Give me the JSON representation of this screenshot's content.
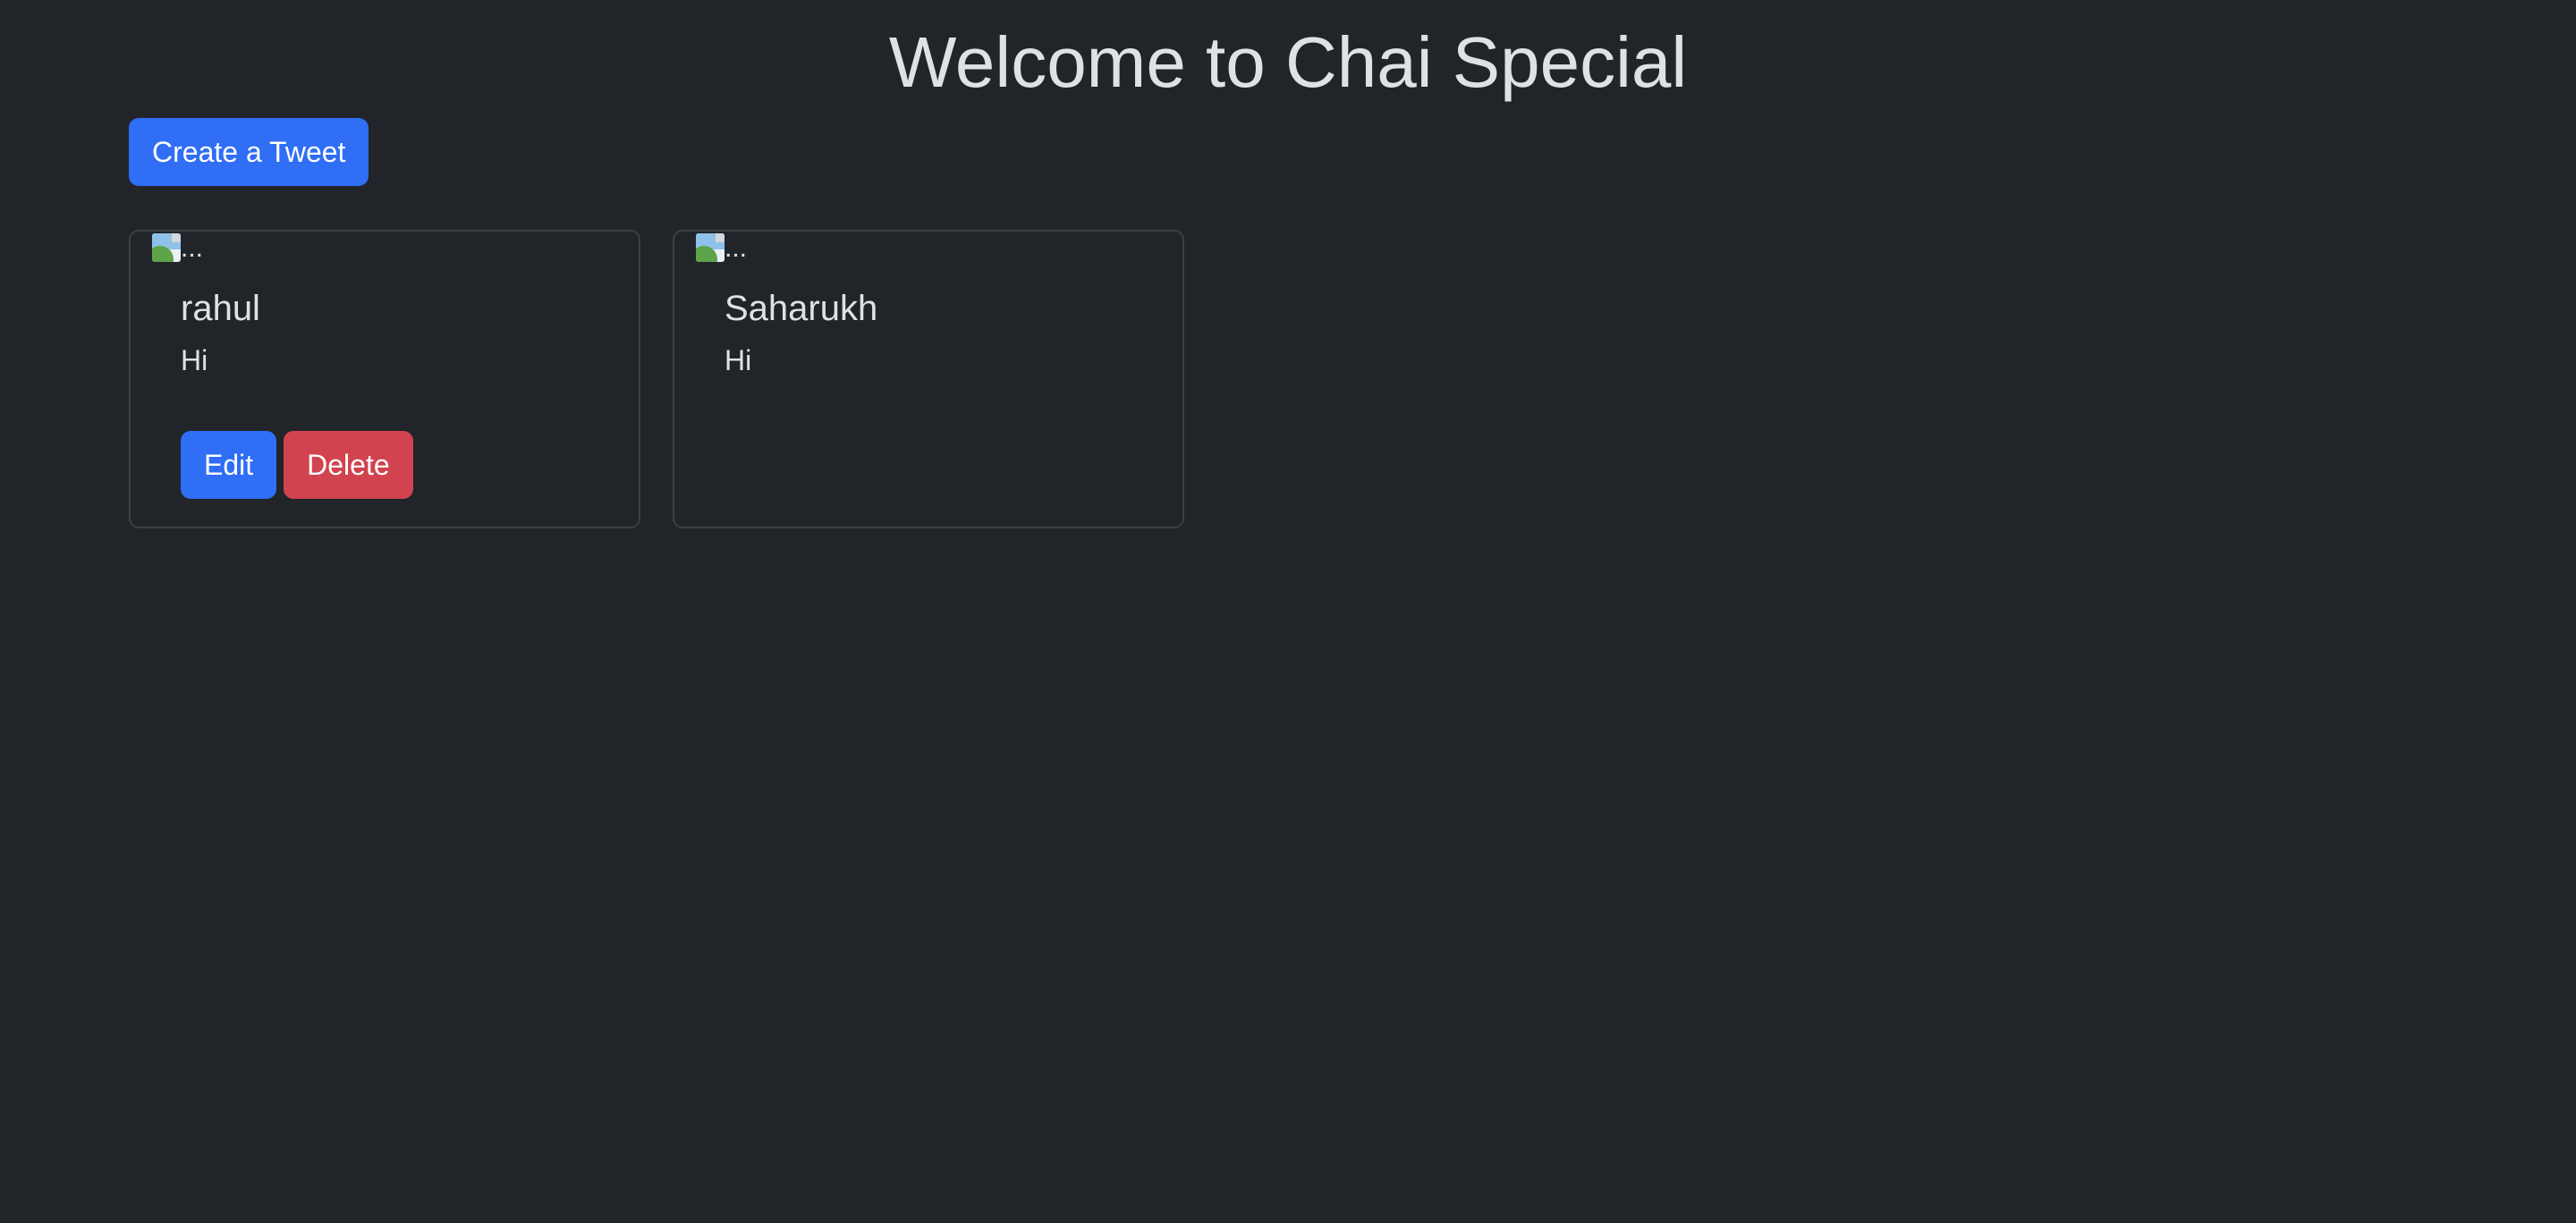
{
  "header": {
    "title": "Welcome to Chai Special"
  },
  "toolbar": {
    "create_label": "Create a Tweet"
  },
  "tweets": [
    {
      "image_alt": "...",
      "author": "rahul",
      "text": "Hi",
      "edit_label": "Edit",
      "delete_label": "Delete"
    },
    {
      "image_alt": "...",
      "author": "Saharukh",
      "text": "Hi"
    }
  ],
  "colors": {
    "background": "#212529",
    "primary": "#2f6ef5",
    "danger": "#d0434f",
    "text": "#dee2e6"
  },
  "icons": {
    "broken_image": "broken-image-icon"
  }
}
